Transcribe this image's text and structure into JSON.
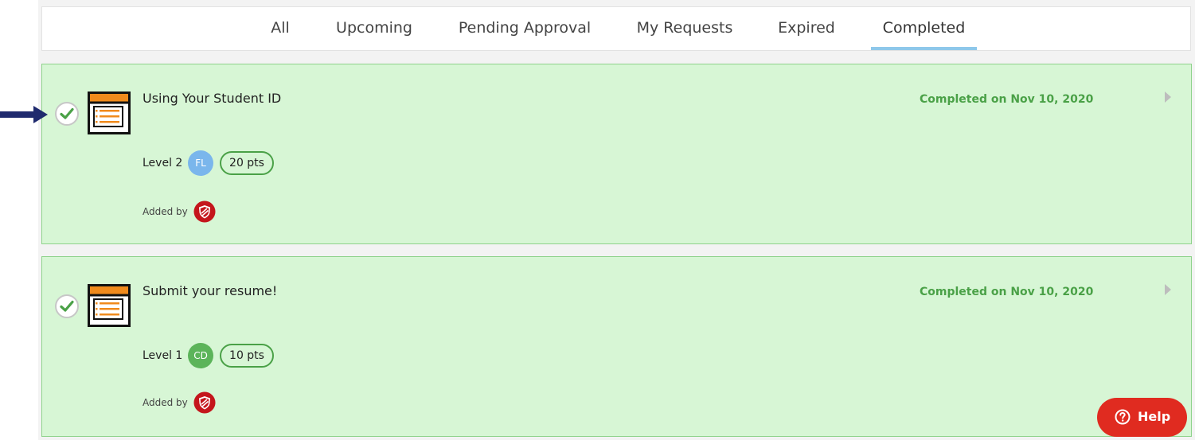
{
  "tabs": [
    {
      "label": "All",
      "active": false
    },
    {
      "label": "Upcoming",
      "active": false
    },
    {
      "label": "Pending Approval",
      "active": false
    },
    {
      "label": "My Requests",
      "active": false
    },
    {
      "label": "Expired",
      "active": false
    },
    {
      "label": "Completed",
      "active": true
    }
  ],
  "items": [
    {
      "title": "Using Your Student ID",
      "completed_text": "Completed on Nov 10, 2020",
      "level": "Level 2",
      "avatar_initials": "FL",
      "avatar_color": "#7ab6ec",
      "points": "20 pts",
      "added_by": "Added by"
    },
    {
      "title": "Submit your resume!",
      "completed_text": "Completed on Nov 10, 2020",
      "level": "Level 1",
      "avatar_initials": "CD",
      "avatar_color": "#5cb45a",
      "points": "10 pts",
      "added_by": "Added by"
    }
  ],
  "help": {
    "label": "Help"
  },
  "colors": {
    "card_bg": "#d7f6d5",
    "card_border": "#8ed28b",
    "completed_text": "#4aa147",
    "tab_underline": "#8ec8ea",
    "help_bg": "#e02b20",
    "arrow": "#1f2a6e"
  }
}
